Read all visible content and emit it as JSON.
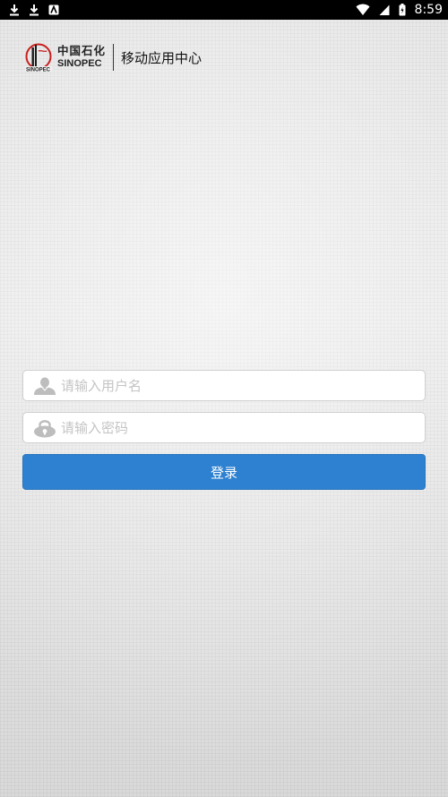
{
  "status_bar": {
    "time": "8:59",
    "left_icons": [
      "download-icon",
      "download-icon",
      "app-notification-icon"
    ],
    "right_icons": [
      "wifi-icon",
      "cell-signal-icon",
      "battery-icon"
    ]
  },
  "header": {
    "logo_cn": "中国石化",
    "logo_en": "SINOPEC",
    "app_title": "移动应用中心"
  },
  "login_form": {
    "username_placeholder": "请输入用户名",
    "username_value": "",
    "password_placeholder": "请输入密码",
    "password_value": "",
    "login_label": "登录"
  },
  "colors": {
    "accent": "#2e81d0",
    "status_bar": "#000000",
    "background": "#e6e6e6"
  }
}
